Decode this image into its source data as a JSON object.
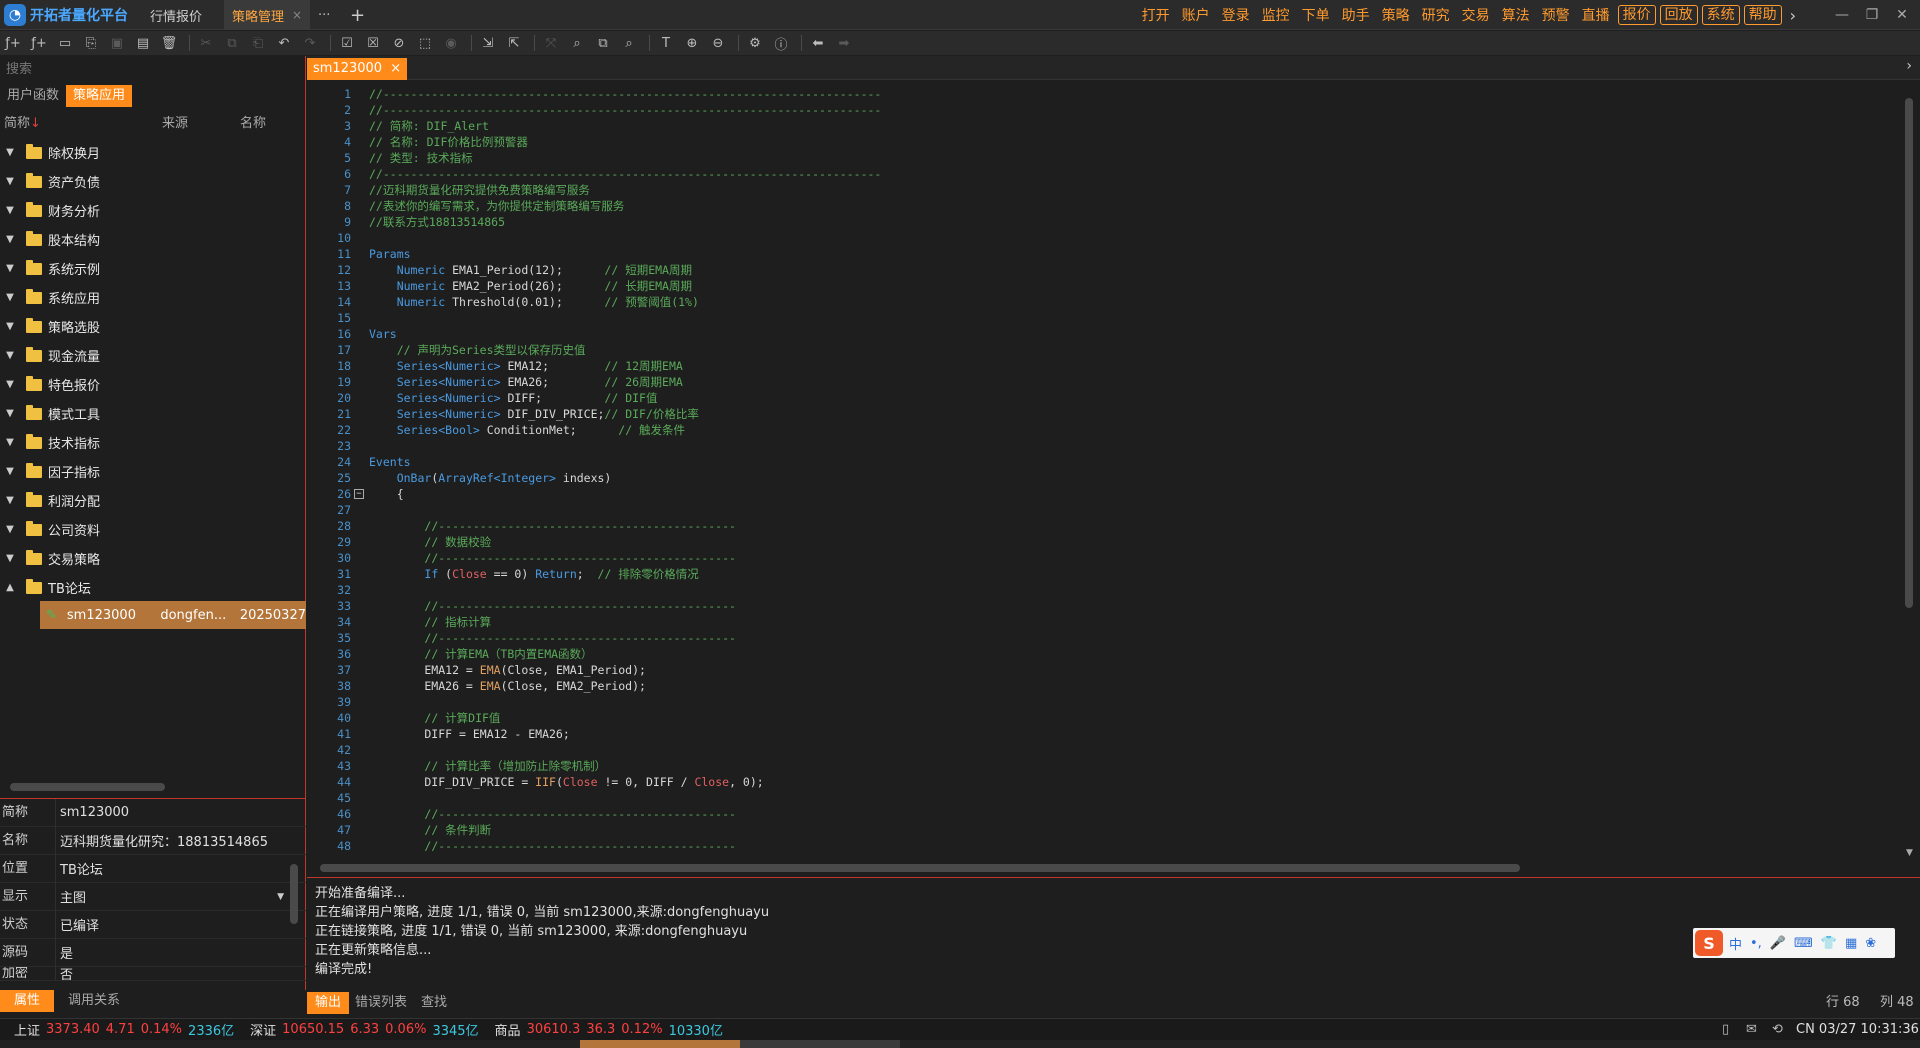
{
  "app": {
    "logo_text": "开拓者量化平台",
    "tabs": [
      {
        "label": "行情报价"
      },
      {
        "label": "策略管理",
        "close": "×"
      }
    ],
    "more_label": "···",
    "add_label": "+"
  },
  "top_menu": {
    "items": [
      "打开",
      "账户",
      "登录",
      "监控",
      "下单",
      "助手",
      "策略",
      "研究",
      "交易",
      "算法",
      "预警",
      "直播"
    ],
    "boxed_items": [
      "报价",
      "回放",
      "系统",
      "帮助"
    ],
    "more_arrow": "›"
  },
  "window_controls": {
    "minimize": "—",
    "maximize": "❐",
    "close": "✕"
  },
  "left_panel": {
    "search_placeholder": "搜索",
    "tabs": [
      "用户函数",
      "策略应用"
    ],
    "columns": {
      "short_name": "简称",
      "sort_arrow": "↓",
      "source": "来源",
      "name": "名称"
    },
    "folders": [
      "除权换月",
      "资产负债",
      "财务分析",
      "股本结构",
      "系统示例",
      "系统应用",
      "策略选股",
      "现金流量",
      "特色报价",
      "模式工具",
      "技术指标",
      "因子指标",
      "利润分配",
      "公司资料",
      "交易策略",
      "TB论坛"
    ],
    "selected_leaf": {
      "short_name": "sm123000",
      "source": "dongfen...",
      "name": "20250327"
    },
    "properties": [
      {
        "key": "简称",
        "value": "sm123000"
      },
      {
        "key": "名称",
        "value": "迈科期货量化研究：18813514865"
      },
      {
        "key": "位置",
        "value": "TB论坛"
      },
      {
        "key": "显示",
        "value": "主图"
      },
      {
        "key": "状态",
        "value": "已编译"
      },
      {
        "key": "源码",
        "value": "是"
      },
      {
        "key": "加密",
        "value": "否"
      }
    ],
    "bottom_tabs": [
      "属性",
      "调用关系"
    ]
  },
  "editor": {
    "tab_label": "sm123000",
    "tab_close": "×",
    "lines": [
      {
        "n": "1",
        "segs": [
          {
            "t": "//------------------------------------------------------------------------",
            "c": "com"
          }
        ]
      },
      {
        "n": "2",
        "segs": [
          {
            "t": "//------------------------------------------------------------------------",
            "c": "com"
          }
        ]
      },
      {
        "n": "3",
        "segs": [
          {
            "t": "// 简称: DIF_Alert",
            "c": "com"
          }
        ]
      },
      {
        "n": "4",
        "segs": [
          {
            "t": "// 名称: DIF价格比例预警器",
            "c": "com"
          }
        ]
      },
      {
        "n": "5",
        "segs": [
          {
            "t": "// 类型: 技术指标",
            "c": "com"
          }
        ]
      },
      {
        "n": "6",
        "segs": [
          {
            "t": "//------------------------------------------------------------------------",
            "c": "com"
          }
        ]
      },
      {
        "n": "7",
        "segs": [
          {
            "t": "//迈科期货量化研究提供免费策略编写服务",
            "c": "com"
          }
        ]
      },
      {
        "n": "8",
        "segs": [
          {
            "t": "//表述你的编写需求，为你提供定制策略编写服务",
            "c": "com"
          }
        ]
      },
      {
        "n": "9",
        "segs": [
          {
            "t": "//联系方式18813514865",
            "c": "com"
          }
        ]
      },
      {
        "n": "10",
        "segs": []
      },
      {
        "n": "11",
        "segs": [
          {
            "t": "Params",
            "c": "kw"
          }
        ]
      },
      {
        "n": "12",
        "segs": [
          {
            "t": "    "
          },
          {
            "t": "Numeric",
            "c": "kw"
          },
          {
            "t": " EMA1_Period(12);      "
          },
          {
            "t": "// 短期EMA周期",
            "c": "com"
          }
        ]
      },
      {
        "n": "13",
        "segs": [
          {
            "t": "    "
          },
          {
            "t": "Numeric",
            "c": "kw"
          },
          {
            "t": " EMA2_Period(26);      "
          },
          {
            "t": "// 长期EMA周期",
            "c": "com"
          }
        ]
      },
      {
        "n": "14",
        "segs": [
          {
            "t": "    "
          },
          {
            "t": "Numeric",
            "c": "kw"
          },
          {
            "t": " Threshold(0.01);      "
          },
          {
            "t": "// 预警阈值(1%)",
            "c": "com"
          }
        ]
      },
      {
        "n": "15",
        "segs": []
      },
      {
        "n": "16",
        "segs": [
          {
            "t": "Vars",
            "c": "kw"
          }
        ]
      },
      {
        "n": "17",
        "segs": [
          {
            "t": "    "
          },
          {
            "t": "// 声明为Series类型以保存历史值",
            "c": "com"
          }
        ]
      },
      {
        "n": "18",
        "segs": [
          {
            "t": "    "
          },
          {
            "t": "Series<Numeric>",
            "c": "kw"
          },
          {
            "t": " EMA12;        "
          },
          {
            "t": "// 12周期EMA",
            "c": "com"
          }
        ]
      },
      {
        "n": "19",
        "segs": [
          {
            "t": "    "
          },
          {
            "t": "Series<Numeric>",
            "c": "kw"
          },
          {
            "t": " EMA26;        "
          },
          {
            "t": "// 26周期EMA",
            "c": "com"
          }
        ]
      },
      {
        "n": "20",
        "segs": [
          {
            "t": "    "
          },
          {
            "t": "Series<Numeric>",
            "c": "kw"
          },
          {
            "t": " DIFF;         "
          },
          {
            "t": "// DIF值",
            "c": "com"
          }
        ]
      },
      {
        "n": "21",
        "segs": [
          {
            "t": "    "
          },
          {
            "t": "Series<Numeric>",
            "c": "kw"
          },
          {
            "t": " DIF_DIV_PRICE;"
          },
          {
            "t": "// DIF/价格比率",
            "c": "com"
          }
        ]
      },
      {
        "n": "22",
        "segs": [
          {
            "t": "    "
          },
          {
            "t": "Series<Bool>",
            "c": "kw"
          },
          {
            "t": " ConditionMet;      "
          },
          {
            "t": "// 触发条件",
            "c": "com"
          }
        ]
      },
      {
        "n": "23",
        "segs": []
      },
      {
        "n": "24",
        "segs": [
          {
            "t": "Events",
            "c": "kw"
          }
        ]
      },
      {
        "n": "25",
        "segs": [
          {
            "t": "    "
          },
          {
            "t": "OnBar",
            "c": "kw"
          },
          {
            "t": "("
          },
          {
            "t": "ArrayRef<Integer>",
            "c": "kw"
          },
          {
            "t": " indexs)"
          }
        ]
      },
      {
        "n": "26",
        "segs": [
          {
            "t": "    {"
          }
        ],
        "fold": "−"
      },
      {
        "n": "27",
        "segs": []
      },
      {
        "n": "28",
        "segs": [
          {
            "t": "        "
          },
          {
            "t": "//-------------------------------------------",
            "c": "com"
          }
        ]
      },
      {
        "n": "29",
        "segs": [
          {
            "t": "        "
          },
          {
            "t": "// 数据校验",
            "c": "com"
          }
        ]
      },
      {
        "n": "30",
        "segs": [
          {
            "t": "        "
          },
          {
            "t": "//-------------------------------------------",
            "c": "com"
          }
        ]
      },
      {
        "n": "31",
        "segs": [
          {
            "t": "        "
          },
          {
            "t": "If",
            "c": "kw"
          },
          {
            "t": " ("
          },
          {
            "t": "Close",
            "c": "red"
          },
          {
            "t": " == 0) "
          },
          {
            "t": "Return",
            "c": "kw"
          },
          {
            "t": ";  "
          },
          {
            "t": "// 排除零价格情况",
            "c": "com"
          }
        ]
      },
      {
        "n": "32",
        "segs": []
      },
      {
        "n": "33",
        "segs": [
          {
            "t": "        "
          },
          {
            "t": "//-------------------------------------------",
            "c": "com"
          }
        ]
      },
      {
        "n": "34",
        "segs": [
          {
            "t": "        "
          },
          {
            "t": "// 指标计算",
            "c": "com"
          }
        ]
      },
      {
        "n": "35",
        "segs": [
          {
            "t": "        "
          },
          {
            "t": "//-------------------------------------------",
            "c": "com"
          }
        ]
      },
      {
        "n": "36",
        "segs": [
          {
            "t": "        "
          },
          {
            "t": "// 计算EMA（TB内置EMA函数）",
            "c": "com"
          }
        ]
      },
      {
        "n": "37",
        "segs": [
          {
            "t": "        EMA12 = "
          },
          {
            "t": "EMA",
            "c": "fn"
          },
          {
            "t": "(Close, EMA1_Period);"
          }
        ]
      },
      {
        "n": "38",
        "segs": [
          {
            "t": "        EMA26 = "
          },
          {
            "t": "EMA",
            "c": "fn"
          },
          {
            "t": "(Close, EMA2_Period);"
          }
        ]
      },
      {
        "n": "39",
        "segs": []
      },
      {
        "n": "40",
        "segs": [
          {
            "t": "        "
          },
          {
            "t": "// 计算DIF值",
            "c": "com"
          }
        ]
      },
      {
        "n": "41",
        "segs": [
          {
            "t": "        DIFF = EMA12 - EMA26;"
          }
        ]
      },
      {
        "n": "42",
        "segs": []
      },
      {
        "n": "43",
        "segs": [
          {
            "t": "        "
          },
          {
            "t": "// 计算比率（增加防止除零机制）",
            "c": "com"
          }
        ]
      },
      {
        "n": "44",
        "segs": [
          {
            "t": "        DIF_DIV_PRICE = "
          },
          {
            "t": "IIF",
            "c": "fn"
          },
          {
            "t": "("
          },
          {
            "t": "Close",
            "c": "red"
          },
          {
            "t": " != 0, DIFF / "
          },
          {
            "t": "Close",
            "c": "red"
          },
          {
            "t": ", 0);"
          }
        ]
      },
      {
        "n": "45",
        "segs": []
      },
      {
        "n": "46",
        "segs": [
          {
            "t": "        "
          },
          {
            "t": "//-------------------------------------------",
            "c": "com"
          }
        ]
      },
      {
        "n": "47",
        "segs": [
          {
            "t": "        "
          },
          {
            "t": "// 条件判断",
            "c": "com"
          }
        ]
      },
      {
        "n": "48",
        "segs": [
          {
            "t": "        "
          },
          {
            "t": "//-------------------------------------------",
            "c": "com"
          }
        ]
      }
    ]
  },
  "output": {
    "lines": [
      "开始准备编译...",
      "正在编译用户策略, 进度 1/1, 错误 0, 当前 sm123000,来源:dongfenghuayu",
      "正在链接策略, 进度 1/1, 错误 0, 当前 sm123000, 来源:dongfenghuayu",
      "正在更新策略信息...",
      "编译完成!"
    ],
    "tabs": [
      "输出",
      "错误列表",
      "查找"
    ],
    "row_label": "行 68",
    "col_label": "列 48"
  },
  "ime": {
    "logo": "S",
    "items": [
      "中",
      "•,",
      "🎤",
      "⌨",
      "👕",
      "▦",
      "❀"
    ]
  },
  "market": {
    "items": [
      {
        "name": "上证",
        "price": "3373.40",
        "change": "4.71",
        "pct": "0.14%",
        "volume": "2336亿"
      },
      {
        "name": "深证",
        "price": "10650.15",
        "change": "6.33",
        "pct": "0.06%",
        "volume": "3345亿"
      },
      {
        "name": "商品",
        "price": "30610.3",
        "change": "36.3",
        "pct": "0.12%",
        "volume": "10330亿"
      }
    ],
    "clock": "CN 03/27 10:31:36"
  },
  "colors": {
    "accent": "#ff8c1a",
    "menu": "#ff9a2e",
    "up": "#ff4040",
    "volume": "#3cc8e0",
    "divider": "#c0392b"
  }
}
